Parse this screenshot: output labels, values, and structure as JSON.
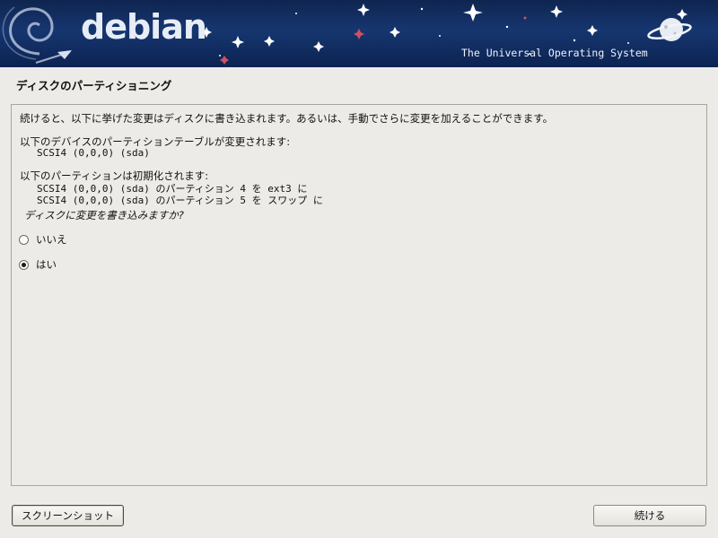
{
  "banner": {
    "logo": "debian",
    "tagline": "The Universal Operating System"
  },
  "page": {
    "title": "ディスクのパーティショニング"
  },
  "panel": {
    "intro": "続けると、以下に挙げた変更はディスクに書き込まれます。あるいは、手動でさらに変更を加えることができます。",
    "devices_header": "以下のデバイスのパーティションテーブルが変更されます:",
    "devices": [
      "SCSI4 (0,0,0) (sda)"
    ],
    "partitions_header": "以下のパーティションは初期化されます:",
    "partitions": [
      "SCSI4 (0,0,0) (sda) のパーティション 4 を ext3 に",
      "SCSI4 (0,0,0) (sda) のパーティション 5 を スワップ に"
    ],
    "question": "ディスクに変更を書き込みますか?",
    "options": [
      {
        "label": "いいえ",
        "selected": false
      },
      {
        "label": "はい",
        "selected": true
      }
    ]
  },
  "buttons": {
    "screenshot": "スクリーンショット",
    "continue": "続ける"
  },
  "colors": {
    "banner_bg": "#163670",
    "page_bg": "#edebe7",
    "panel_border": "#a9a59e"
  }
}
